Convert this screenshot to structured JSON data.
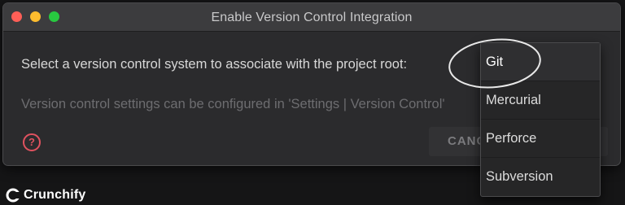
{
  "window": {
    "title": "Enable Version Control Integration"
  },
  "dialog": {
    "prompt": "Select a version control system to associate with the project root:",
    "hint": "Version control settings can be configured in 'Settings | Version Control'",
    "help_icon_glyph": "?",
    "cancel_label": "CANCEL"
  },
  "dropdown": {
    "items": [
      {
        "label": "Git",
        "selected": true
      },
      {
        "label": "Mercurial",
        "selected": false
      },
      {
        "label": "Perforce",
        "selected": false
      },
      {
        "label": "Subversion",
        "selected": false
      }
    ]
  },
  "annotation": {
    "color": "#e8e8e8"
  },
  "watermark": {
    "text": "Crunchify"
  },
  "colors": {
    "close": "#ff5f57",
    "minimize": "#febc2e",
    "zoom": "#28c840",
    "help": "#e0525f"
  }
}
